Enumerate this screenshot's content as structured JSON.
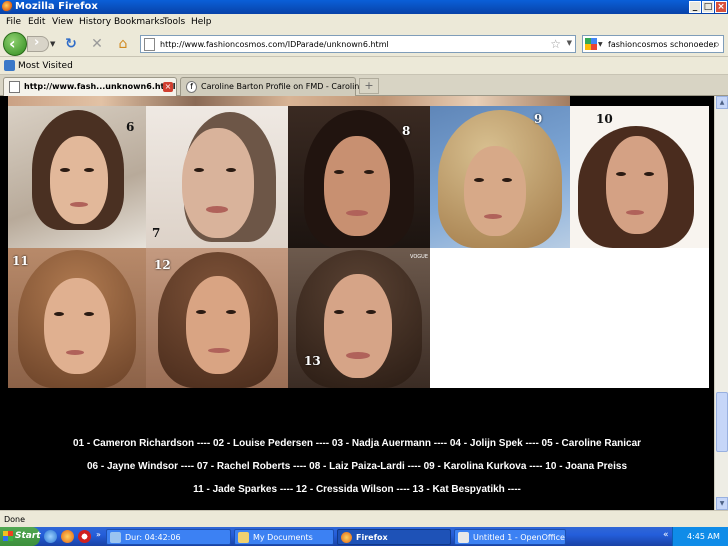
{
  "window": {
    "title": "Mozilla Firefox",
    "minimize": "_",
    "maximize": "□",
    "close": "×"
  },
  "menu": [
    "File",
    "Edit",
    "View",
    "History",
    "Bookmarks",
    "Tools",
    "Help"
  ],
  "nav": {
    "url": "http://www.fashioncosmos.com/IDParade/unknown6.html",
    "search_value": "fashioncosmos schonoeder"
  },
  "bookmarks": {
    "most_visited": "Most Visited"
  },
  "tabs": [
    {
      "label": "http://www.fash...unknown6.html",
      "active": true
    },
    {
      "label": "Caroline Barton Profile on FMD - Carolin...",
      "active": false
    }
  ],
  "gallery": {
    "numbers": [
      "6",
      "7",
      "8",
      "9",
      "10",
      "11",
      "12",
      "13"
    ],
    "watermark": "VOGUE"
  },
  "names": {
    "line1": "01 - Cameron Richardson ---- 02 - Louise Pedersen ---- 03 - Nadja Auermann ---- 04 - Jolijn Spek ---- 05 - Caroline Ranicar",
    "line2": "06 - Jayne Windsor ---- 07 - Rachel Roberts ---- 08 - Laiz Paiza-Lardi ---- 09 - Karolina Kurkova ---- 10 - Joana Preiss",
    "line3": "11 - Jade Sparkes ---- 12 - Cressida Wilson ---- 13 - Kat Bespyatikh ----"
  },
  "status": {
    "text": "Done"
  },
  "taskbar": {
    "start": "Start",
    "tasks": [
      {
        "label": "Dur: 04:42:06"
      },
      {
        "label": "My Documents"
      },
      {
        "label": "Firefox",
        "active": true
      },
      {
        "label": "Untitled 1 - OpenOffice...."
      }
    ],
    "clock": "4:45 AM"
  },
  "colors": {
    "titlebar": "#0a5fd8",
    "taskbar": "#245edb",
    "tray": "#0f8ce8",
    "content_bg": "#000000"
  }
}
